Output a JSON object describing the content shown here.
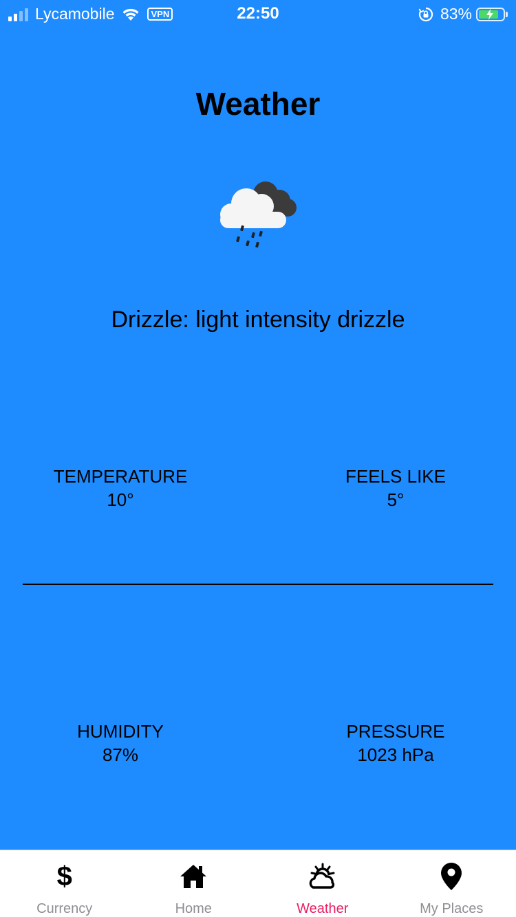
{
  "status_bar": {
    "carrier": "Lycamobile",
    "vpn": "VPN",
    "time": "22:50",
    "battery_percent": "83%",
    "battery_level": 0.83,
    "icons": [
      "signal-icon",
      "wifi-icon",
      "orientation-lock-icon",
      "battery-icon"
    ]
  },
  "header": {
    "title": "Weather"
  },
  "weather": {
    "icon": "rain-cloud-icon",
    "description": "Drizzle: light intensity drizzle"
  },
  "metrics": {
    "temperature": {
      "label": "TEMPERATURE",
      "value": "10°"
    },
    "feels_like": {
      "label": "FEELS LIKE",
      "value": "5°"
    },
    "humidity": {
      "label": "HUMIDITY",
      "value": "87%"
    },
    "pressure": {
      "label": "PRESSURE",
      "value": "1023 hPa"
    }
  },
  "tabs": [
    {
      "label": "Currency",
      "icon": "dollar-icon",
      "active": false
    },
    {
      "label": "Home",
      "icon": "home-icon",
      "active": false
    },
    {
      "label": "Weather",
      "icon": "weather-icon",
      "active": true
    },
    {
      "label": "My Places",
      "icon": "location-pin-icon",
      "active": false
    }
  ],
  "colors": {
    "background": "#1e8bff",
    "active_tab": "#e91e63",
    "inactive_tab": "#8e8e93",
    "tab_bar_bg": "#ffffff"
  }
}
